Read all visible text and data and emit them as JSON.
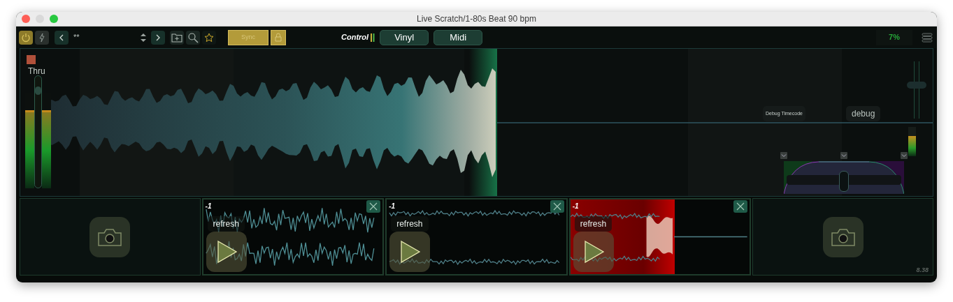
{
  "window": {
    "title": "Live Scratch/1-80s Beat 90 bpm"
  },
  "toolbar": {
    "power_on": true,
    "bolt_on": false,
    "track_label": "**",
    "sync": {
      "label": "Sync",
      "on": true
    },
    "control_label": "Control",
    "modes": [
      {
        "label": "Vinyl"
      },
      {
        "label": "Midi"
      }
    ],
    "cpu": "7%"
  },
  "deck": {
    "thru_label": "Thru",
    "thru_on": true,
    "input_meter": [
      {
        "level": 0.82
      },
      {
        "level": 0.82
      }
    ],
    "gain_slider": {
      "level": 0.9
    },
    "pitch_slider": {
      "level": 0.6
    },
    "output_meter": {
      "level": 0.7
    },
    "debug_timecode": "Debug Timecode",
    "debug": "debug",
    "crossfader": {
      "level": 0.5
    },
    "progress": {
      "level": 0.5
    }
  },
  "slots": [
    {
      "kind": "camera"
    },
    {
      "kind": "sample",
      "counter": "-1",
      "button": "refresh",
      "highlighted": false
    },
    {
      "kind": "sample",
      "counter": "-1",
      "button": "refresh",
      "highlighted": false
    },
    {
      "kind": "sample",
      "counter": "-1",
      "button": "refresh",
      "highlighted": true
    },
    {
      "kind": "camera"
    }
  ],
  "time": "8.38"
}
